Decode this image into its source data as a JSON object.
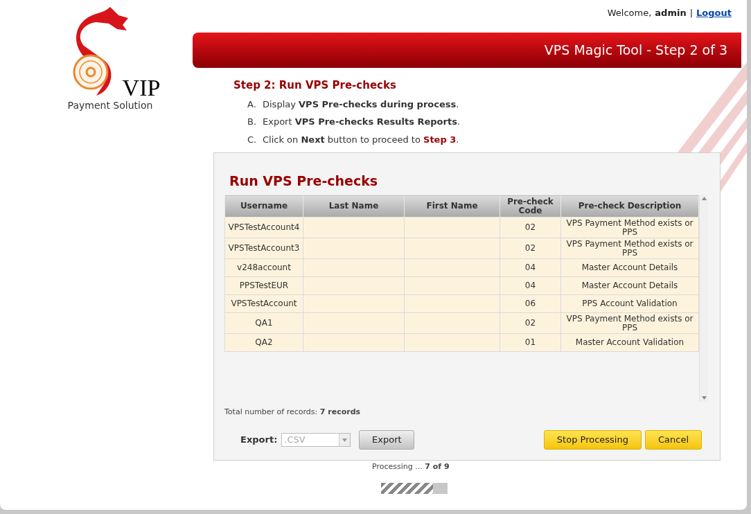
{
  "logo": {
    "brand": "VIP",
    "tagline": "Payment Solution"
  },
  "user": {
    "welcome": "Welcome,",
    "name": "admin",
    "separator": "|",
    "logout": "Logout"
  },
  "banner": {
    "title": "VPS Magic Tool - Step 2 of 3"
  },
  "step": {
    "title": "Step 2: Run VPS Pre-checks",
    "items": [
      {
        "marker": "A.",
        "text": "Display **VPS Pre-checks during process**."
      },
      {
        "marker": "B.",
        "text": "Export **VPS Pre-checks Results Reports**."
      },
      {
        "marker": "C.",
        "text": "Click on **Next** button to proceed to **Step 3**."
      }
    ]
  },
  "panel": {
    "title": "Run VPS Pre-checks",
    "table": {
      "columns": [
        "Username",
        "Last Name",
        "First Name",
        "Pre-check Code",
        "Pre-check Description"
      ],
      "rows": [
        [
          "VPSTestAccount4",
          "",
          "",
          "02",
          "VPS Payment Method exists or PPS"
        ],
        [
          "VPSTestAccount3",
          "",
          "",
          "02",
          "VPS Payment Method exists or PPS"
        ],
        [
          "v248account",
          "",
          "",
          "04",
          "Master Account Details"
        ],
        [
          "PPSTestEUR",
          "",
          "",
          "04",
          "Master Account Details"
        ],
        [
          "VPSTestAccount",
          "",
          "",
          "06",
          "PPS Account Validation"
        ],
        [
          "QA1",
          "",
          "",
          "02",
          "VPS Payment Method exists or PPS"
        ],
        [
          "QA2",
          "",
          "",
          "01",
          "Master Account Validation"
        ]
      ]
    },
    "total": "Total number of records: **7 records**",
    "export": {
      "label": "Export:",
      "value": ".CSV",
      "disabled": true,
      "button": "Export"
    },
    "buttons": [
      "Stop Processing",
      "Cancel"
    ]
  },
  "progress": {
    "text": "Processing ... **7 of 9**",
    "level": 0.78
  }
}
